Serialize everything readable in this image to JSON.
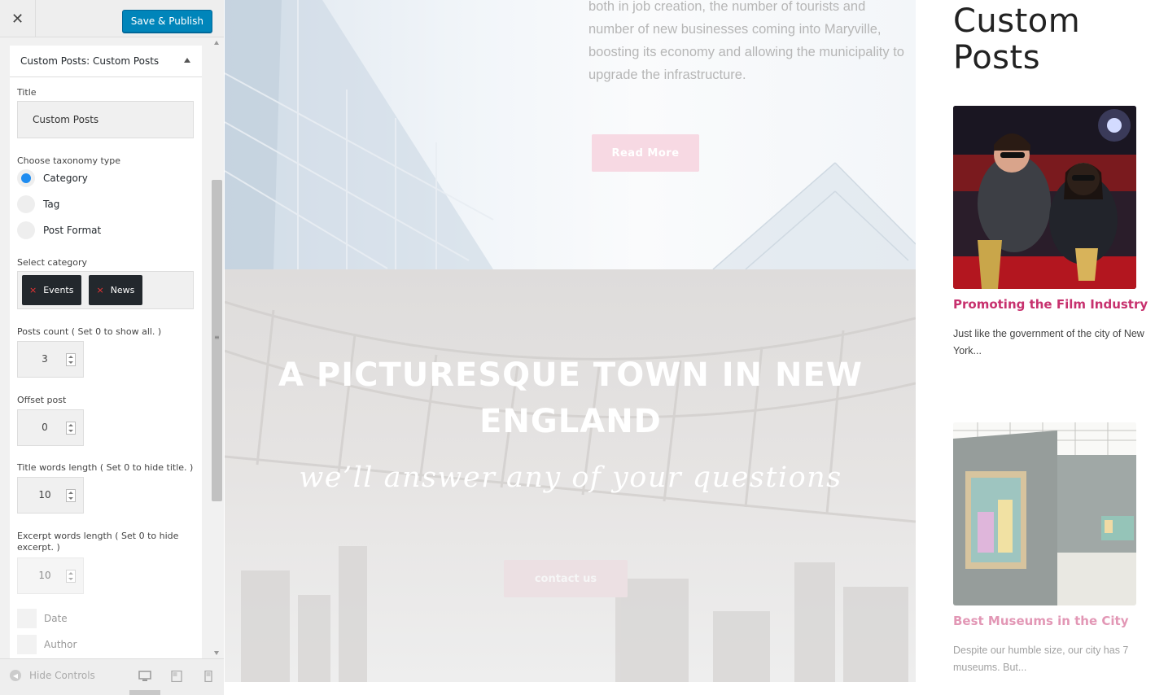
{
  "header": {
    "close_icon": "close-icon",
    "publish_label": "Save & Publish"
  },
  "section": {
    "prefix": "Custom Posts:",
    "name": "Custom Posts"
  },
  "form": {
    "title_label": "Title",
    "title_value": "Custom Posts",
    "taxonomy_label": "Choose taxonomy type",
    "taxonomy_options": [
      "Category",
      "Tag",
      "Post Format"
    ],
    "taxonomy_selected": "Category",
    "category_label": "Select category",
    "categories": [
      "Events",
      "News"
    ],
    "chip_remove": "×",
    "posts_count_label": "Posts count ( Set 0 to show all. )",
    "posts_count": "3",
    "offset_label": "Offset post",
    "offset": "0",
    "title_words_label": "Title words length ( Set 0 to hide title. )",
    "title_words": "10",
    "excerpt_words_label": "Excerpt words length ( Set 0 to hide excerpt. )",
    "excerpt_words": "10",
    "date_label": "Date",
    "author_label": "Author"
  },
  "footer": {
    "hide_controls": "Hide Controls"
  },
  "preview": {
    "intro_text": "both in job creation, the number of tourists and number of new businesses coming into Maryville, boosting its economy and allowing the municipality to upgrade the infrastructure.",
    "read_more": "Read More",
    "headline": "A PICTURESQUE TOWN IN NEW ENGLAND",
    "subheadline": "we’ll answer any of your questions",
    "contact": "contact us"
  },
  "widget": {
    "title": "Custom Posts",
    "posts": [
      {
        "title": "Promoting the Film Industry",
        "excerpt": "Just like the government of the city of New York..."
      },
      {
        "title": "Best Museums in the City",
        "excerpt": "Despite our humble size, our city has 7 museums. But..."
      }
    ]
  },
  "colors": {
    "accent": "#0085ba",
    "post_title": "#c7316e",
    "radio": "#1e8cf0",
    "chip": "#23282d"
  }
}
